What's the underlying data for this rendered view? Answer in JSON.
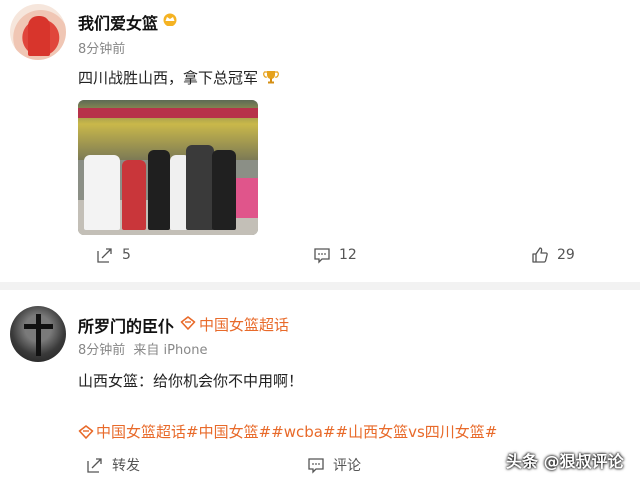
{
  "posts": [
    {
      "username": "我们爱女篮",
      "time": "8分钟前",
      "text": "四川战胜山西，拿下总冠军",
      "actions": {
        "repost": "5",
        "comment": "12",
        "like": "29"
      }
    },
    {
      "username": "所罗门的臣仆",
      "supertopic": "中国女篮超话",
      "time": "8分钟前",
      "source": "来自 iPhone",
      "text": "山西女篮：给你机会你不中用啊！",
      "topics": "中国女篮超话#中国女篮##wcba##山西女篮vs四川女篮#",
      "actions": {
        "repost": "转发",
        "comment": "评论"
      }
    }
  ],
  "watermark": "头条 @狠叔评论",
  "colors": {
    "accent": "#e86a2a",
    "separator": "#f2f2f2"
  },
  "icons": [
    "crown-icon",
    "trophy-icon",
    "repost-icon",
    "comment-icon",
    "like-icon",
    "supertopic-icon"
  ]
}
